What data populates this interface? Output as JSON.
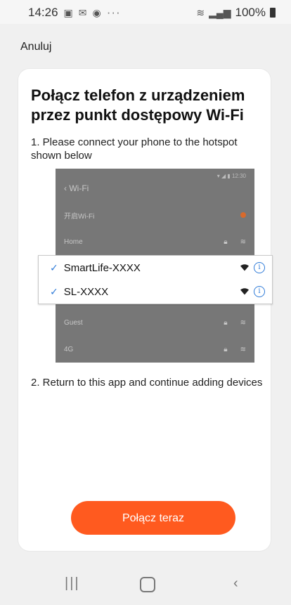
{
  "status_bar": {
    "time": "14:26",
    "left_icons": [
      "gallery-icon",
      "mail-icon",
      "messenger-icon"
    ],
    "more": "···",
    "battery": "100%"
  },
  "header": {
    "cancel_label": "Anuluj"
  },
  "card": {
    "title": "Połącz telefon z urządzeniem przez punkt dostępowy Wi-Fi",
    "step1": "1. Please connect your phone to the hotspot shown below",
    "step2": "2. Return to this app and continue adding devices",
    "illustration": {
      "status_time": "12:30",
      "back_label": "‹ Wi-Fi",
      "open_wifi_label": "开启Wi-Fi",
      "home_label": "Home",
      "guest_label": "Guest",
      "g4_label": "4G",
      "networks": [
        {
          "name": "SmartLife-XXXX"
        },
        {
          "name": "SL-XXXX"
        }
      ]
    },
    "connect_button": "Połącz teraz"
  },
  "colors": {
    "accent": "#ff5a1f",
    "check_blue": "#2f7bd8",
    "illustration_bg": "#777777"
  }
}
